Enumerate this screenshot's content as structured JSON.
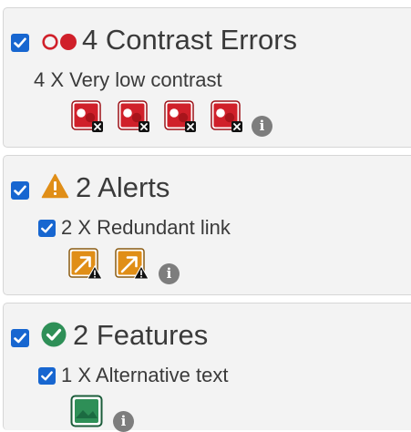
{
  "colors": {
    "checkbox": "#1766d0",
    "error_red": "#d0202a",
    "alert_orange": "#e08e17",
    "feature_green": "#2e8f57",
    "panel_bg": "#f3f3f3"
  },
  "errors_section": {
    "heading": "4 Contrast Errors",
    "checked": true,
    "header_icon": "contrast-error-icon",
    "items": [
      {
        "label": "4 X Very low contrast",
        "icon": "contrast-error-icon",
        "count": 4
      }
    ]
  },
  "alerts_section": {
    "heading": "2 Alerts",
    "checked": true,
    "header_icon": "warning-triangle-icon",
    "items": [
      {
        "label": "2 X Redundant link",
        "checked": true,
        "icon": "redundant-link-icon",
        "count": 2
      }
    ]
  },
  "features_section": {
    "heading": "2 Features",
    "checked": true,
    "header_icon": "check-circle-icon",
    "items": [
      {
        "label": "1 X Alternative text",
        "checked": true,
        "icon": "alt-text-icon",
        "count": 1
      }
    ]
  },
  "info_glyph": "i"
}
